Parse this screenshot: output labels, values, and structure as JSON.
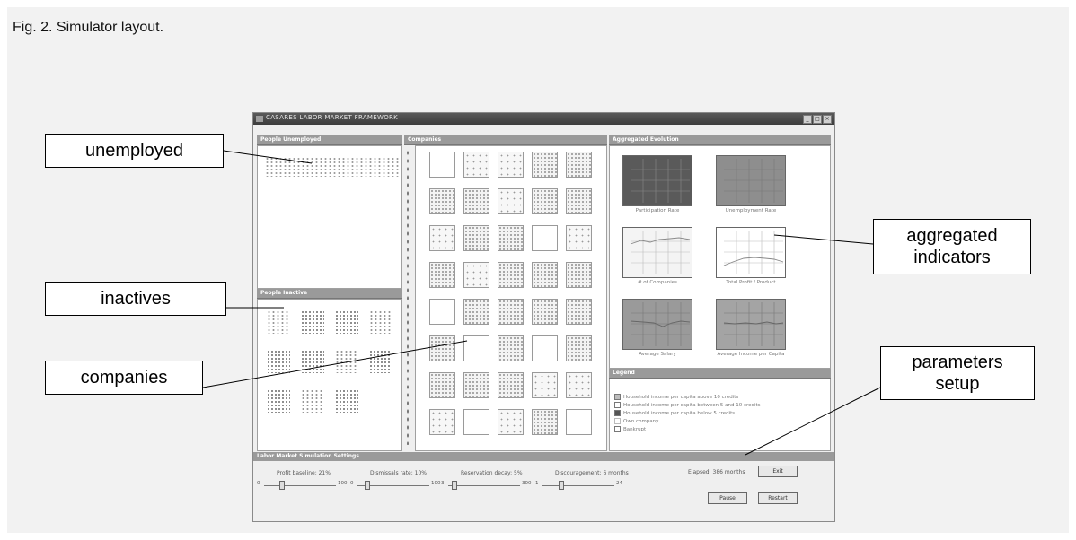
{
  "figure": {
    "caption": "Fig. 2. Simulator layout."
  },
  "window": {
    "title": "CASARES LABOR MARKET FRAMEWORK",
    "minimize_glyph": "_",
    "maximize_glyph": "□",
    "close_glyph": "×"
  },
  "panels": {
    "unemployed": "People Unemployed",
    "inactive": "People Inactive",
    "companies": "Companies",
    "aggregated": "Aggregated Evolution",
    "legend": "Legend"
  },
  "charts": [
    {
      "label": "Participation Rate",
      "fill": "#5a5a5a"
    },
    {
      "label": "Unemployment Rate",
      "fill": "#8e8e8e"
    },
    {
      "label": "# of Companies",
      "fill": "#f4f4f4"
    },
    {
      "label": "Total Profit / Product",
      "fill": "#ffffff"
    },
    {
      "label": "Average Salary",
      "fill": "#9a9a9a"
    },
    {
      "label": "Average Income per Capita",
      "fill": "#a4a4a4"
    }
  ],
  "legend_items": [
    "Household income per capita above 10 credits",
    "Household income per capita between 5 and 10 credits",
    "Household income per capita below 5 credits",
    "Own company",
    "Bankrupt"
  ],
  "settings": {
    "title": "Labor Market Simulation Settings",
    "sliders": [
      {
        "label": "Profit baseline: 21%",
        "min": "0",
        "max": "100",
        "value": 0.21
      },
      {
        "label": "Dismissals rate: 10%",
        "min": "0",
        "max": "100",
        "value": 0.1
      },
      {
        "label": "Reservation decay: 5%",
        "min": "3",
        "max": "300",
        "value": 0.05
      },
      {
        "label": "Discouragement: 6 months",
        "min": "1",
        "max": "24",
        "value": 0.22
      }
    ],
    "elapsed": "Elapsed: 386 months",
    "exit_label": "Exit",
    "pause_label": "Pause",
    "restart_label": "Restart"
  },
  "annotations": {
    "unemployed": "unemployed",
    "inactives": "inactives",
    "companies": "companies",
    "aggregated": "aggregated indicators",
    "parameters": "parameters setup"
  }
}
